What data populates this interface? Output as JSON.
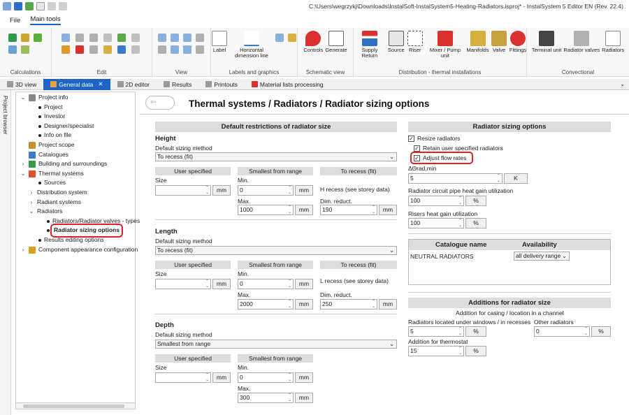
{
  "window": {
    "title": "C:\\Users\\wegrzykj\\Downloads\\InstalSoft-InstalSystem5-Heating-Radiators.isproj* - InstalSystem 5 Editor EN (Rev. 22.4)"
  },
  "menu": {
    "file": "File",
    "main_tools": "Main tools"
  },
  "ribbon": {
    "groups": {
      "calculations": "Calculations",
      "edit": "Edit",
      "view": "View",
      "labels": "Labels and graphics",
      "schematic": "Schematic view",
      "distribution": "Distribution - thermal installations",
      "conventional": "Convectional"
    },
    "buttons": {
      "label": "Label",
      "horizontal_dim": "Horizontal dimension line",
      "controls": "Controls",
      "generate": "Generate",
      "supply_return": "Supply Return",
      "source": "Source",
      "riser": "Riser",
      "mixer_pump": "Mixer / Pump unit",
      "manifolds": "Manifolds",
      "valve": "Valve",
      "fittings": "Fittings",
      "terminal_unit": "Terminal unit",
      "radiator_valves": "Radiator valves",
      "radiators": "Radiators"
    }
  },
  "tabs": [
    "3D view",
    "General data",
    "2D editor",
    "Results",
    "Printouts",
    "Material lists processing"
  ],
  "side": {
    "project_browser": "Project browser"
  },
  "tree": [
    {
      "label": "Project info",
      "indent": 0,
      "arrow": "v",
      "icon": "doc"
    },
    {
      "label": "Project",
      "indent": 1,
      "bullet": true
    },
    {
      "label": "Investor",
      "indent": 1,
      "bullet": true
    },
    {
      "label": "Designer/specialist",
      "indent": 1,
      "bullet": true
    },
    {
      "label": "Info on file",
      "indent": 1,
      "bullet": true
    },
    {
      "label": "Project scope",
      "indent": 0,
      "icon": "scope"
    },
    {
      "label": "Catalogues",
      "indent": 0,
      "icon": "cat"
    },
    {
      "label": "Building and surroundings",
      "indent": 0,
      "arrow": ">",
      "icon": "bld"
    },
    {
      "label": "Thermal systems",
      "indent": 0,
      "arrow": "v",
      "icon": "therm"
    },
    {
      "label": "Sources",
      "indent": 1,
      "bullet": true
    },
    {
      "label": "Distribution system",
      "indent": 1,
      "arrow": ">"
    },
    {
      "label": "Radiant systems",
      "indent": 1,
      "arrow": ">"
    },
    {
      "label": "Radiators",
      "indent": 1,
      "arrow": "v"
    },
    {
      "label": "Radiators/Radiator valves - types",
      "indent": 2,
      "bullet": true
    },
    {
      "label": "Radiator sizing options",
      "indent": 2,
      "bullet": true,
      "selected": true
    },
    {
      "label": "Results editing options",
      "indent": 1,
      "bullet": true
    },
    {
      "label": "Component appearance configuration",
      "indent": 0,
      "arrow": ">",
      "icon": "comp"
    }
  ],
  "page": {
    "title": "Thermal systems / Radiators / Radiator sizing options"
  },
  "left": {
    "header": "Default restrictions of radiator size",
    "default_sizing": "Default sizing method",
    "user_specified": "User specified",
    "smallest": "Smallest from range",
    "to_recess": "To recess (fit)",
    "size": "Size",
    "min": "Min.",
    "max": "Max.",
    "dim_reduct": "Dim. reduct.",
    "mm": "mm",
    "height": {
      "title": "Height",
      "method": "To recess (fit)",
      "min": "0",
      "max": "1000",
      "recess_note": "H recess (see storey data)",
      "reduct": "190"
    },
    "length": {
      "title": "Length",
      "method": "To recess (fit)",
      "min": "0",
      "max": "2000",
      "recess_note": "L recess (see storey data)",
      "reduct": "250"
    },
    "depth": {
      "title": "Depth",
      "method": "Smallest from range",
      "min": "0",
      "max": "300"
    }
  },
  "right": {
    "header": "Radiator sizing options",
    "resize": "Resize radiators",
    "retain": "Retain user specified radiators",
    "adjust": "Adjust flow rates",
    "dtheta_label": "ΔΘrad,min",
    "dtheta_value": "5",
    "dtheta_unit": "K",
    "circuit_label": "Radiator circuit pipe heat gain utilization",
    "circuit_value": "100",
    "pct": "%",
    "risers_label": "Risers heat gain utilization",
    "risers_value": "100",
    "cat_col": "Catalogue name",
    "avail_col": "Availability",
    "catalogue": {
      "name": "NEUTRAL RADIATORS",
      "availability": "all delivery range"
    },
    "add_header": "Additions for radiator size",
    "add_sub": "Addition for casing / location in a channel",
    "under_windows": "Radiators located under windows / in recesses",
    "under_value": "5",
    "other": "Other radiators",
    "other_value": "0",
    "thermostat": "Addition for thermostat",
    "thermostat_value": "15"
  }
}
